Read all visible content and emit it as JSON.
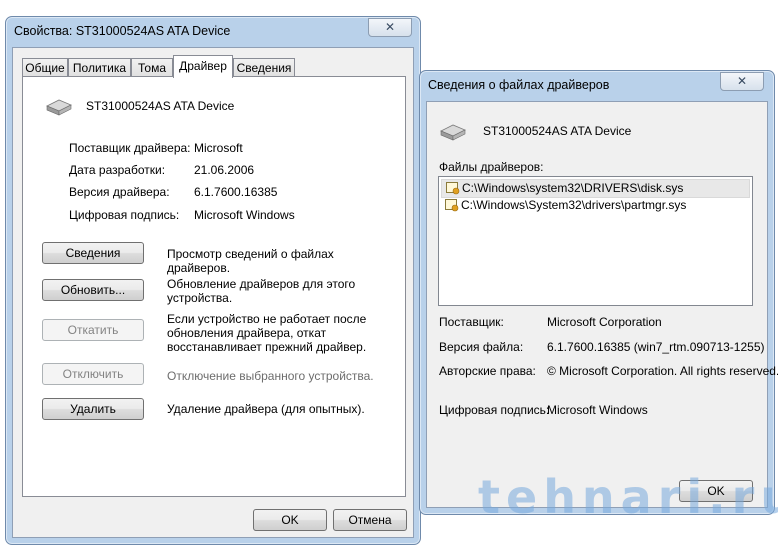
{
  "props_window": {
    "title": "Свойства: ST31000524AS ATA Device",
    "close_glyph": "✕",
    "tabs": [
      {
        "label": "Общие"
      },
      {
        "label": "Политика"
      },
      {
        "label": "Тома"
      },
      {
        "label": "Драйвер"
      },
      {
        "label": "Сведения"
      }
    ],
    "device_name": "ST31000524AS ATA Device",
    "fields": [
      {
        "label": "Поставщик драйвера:",
        "value": "Microsoft"
      },
      {
        "label": "Дата разработки:",
        "value": "21.06.2006"
      },
      {
        "label": "Версия драйвера:",
        "value": "6.1.7600.16385"
      },
      {
        "label": "Цифровая подпись:",
        "value": "Microsoft Windows"
      }
    ],
    "actions": [
      {
        "button": "Сведения",
        "description": "Просмотр сведений о файлах драйверов."
      },
      {
        "button": "Обновить...",
        "description": "Обновление драйверов для этого устройства."
      },
      {
        "button": "Откатить",
        "description": "Если устройство не работает после обновления драйвера, откат восстанавливает прежний драйвер."
      },
      {
        "button": "Отключить",
        "description": "Отключение выбранного устройства."
      },
      {
        "button": "Удалить",
        "description": "Удаление драйвера (для опытных)."
      }
    ],
    "ok_label": "OK",
    "cancel_label": "Отмена"
  },
  "files_window": {
    "title": "Сведения о файлах драйверов",
    "close_glyph": "✕",
    "device_name": "ST31000524AS ATA Device",
    "files_label": "Файлы драйверов:",
    "files": [
      "C:\\Windows\\system32\\DRIVERS\\disk.sys",
      "C:\\Windows\\System32\\drivers\\partmgr.sys"
    ],
    "fields": [
      {
        "label": "Поставщик:",
        "value": "Microsoft Corporation"
      },
      {
        "label": "Версия файла:",
        "value": "6.1.7600.16385 (win7_rtm.090713-1255)"
      },
      {
        "label": "Авторские права:",
        "value": "© Microsoft Corporation. All rights reserved."
      },
      {
        "label": "Цифровая подпись:",
        "value": "Microsoft Windows"
      }
    ],
    "ok_label": "OK"
  },
  "watermark": "tehnari.ru"
}
